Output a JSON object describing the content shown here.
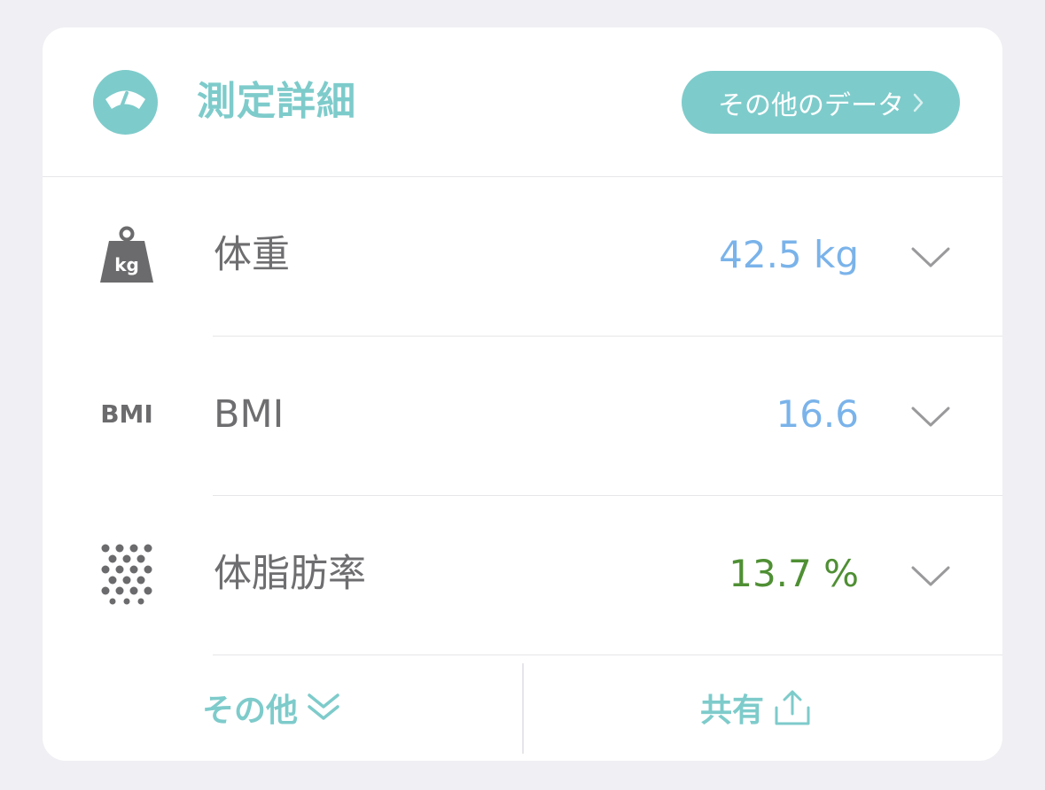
{
  "header": {
    "title": "測定詳細",
    "more_button_label": "その他のデータ"
  },
  "rows": [
    {
      "icon": "weight-kg-icon",
      "icon_text": "kg",
      "label": "体重",
      "value": "42.5 kg",
      "value_color": "#7ab3ea"
    },
    {
      "icon": "bmi-icon",
      "icon_text": "BMI",
      "label": "BMI",
      "value": "16.6",
      "value_color": "#7ab3ea"
    },
    {
      "icon": "body-fat-dots-icon",
      "label": "体脂肪率",
      "value": "13.7 %",
      "value_color": "#4f8f34"
    }
  ],
  "footer": {
    "other_label": "その他",
    "share_label": "共有"
  },
  "colors": {
    "accent": "#7ecbcb",
    "label": "#6e6e70"
  }
}
